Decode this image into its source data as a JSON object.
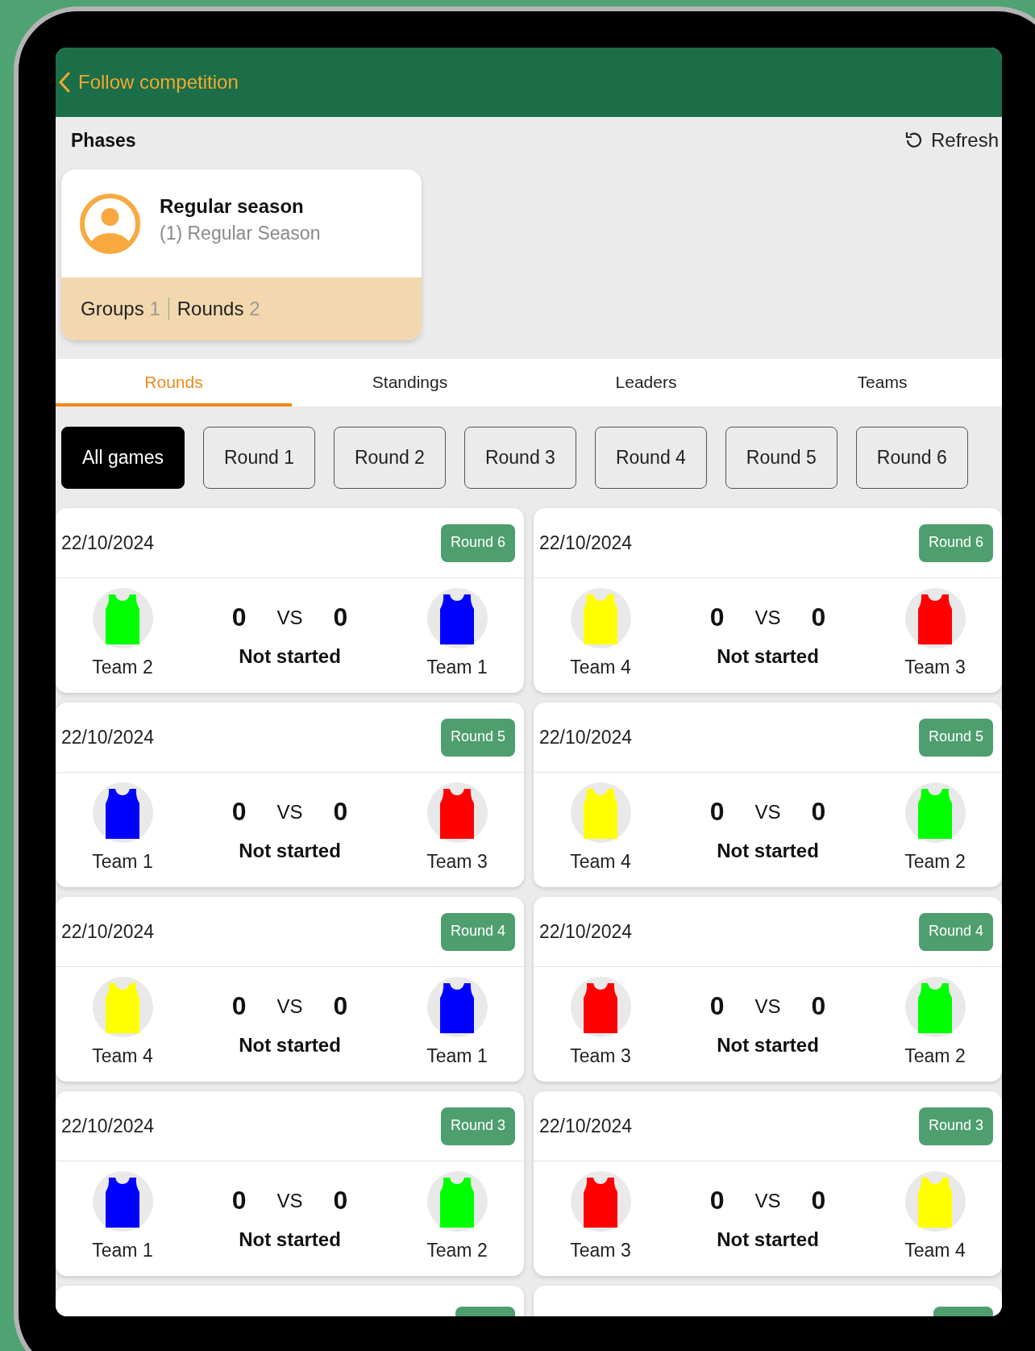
{
  "header": {
    "back_label": "Follow competition"
  },
  "phases_bar": {
    "title": "Phases",
    "refresh_label": "Refresh"
  },
  "phase_card": {
    "title": "Regular season",
    "subtitle": "(1) Regular Season",
    "stats": [
      {
        "label": "Groups",
        "value": "1"
      },
      {
        "label": "Rounds",
        "value": "2"
      }
    ]
  },
  "tabs": [
    {
      "label": "Rounds",
      "selected": true
    },
    {
      "label": "Standings",
      "selected": false
    },
    {
      "label": "Leaders",
      "selected": false
    },
    {
      "label": "Teams",
      "selected": false
    }
  ],
  "round_filters": [
    {
      "label": "All games",
      "selected": true
    },
    {
      "label": "Round 1",
      "selected": false
    },
    {
      "label": "Round 2",
      "selected": false
    },
    {
      "label": "Round 3",
      "selected": false
    },
    {
      "label": "Round 4",
      "selected": false
    },
    {
      "label": "Round 5",
      "selected": false
    },
    {
      "label": "Round 6",
      "selected": false
    }
  ],
  "games": [
    {
      "date": "22/10/2024",
      "round": "Round 6",
      "home": {
        "name": "Team 2",
        "color": "#00ff00"
      },
      "home_score": "0",
      "vs": "VS",
      "away_score": "0",
      "status": "Not started",
      "away": {
        "name": "Team 1",
        "color": "#0000ff"
      }
    },
    {
      "date": "22/10/2024",
      "round": "Round 6",
      "home": {
        "name": "Team 4",
        "color": "#ffff00"
      },
      "home_score": "0",
      "vs": "VS",
      "away_score": "0",
      "status": "Not started",
      "away": {
        "name": "Team 3",
        "color": "#ff0000"
      }
    },
    {
      "date": "22/10/2024",
      "round": "Round 5",
      "home": {
        "name": "Team 1",
        "color": "#0000ff"
      },
      "home_score": "0",
      "vs": "VS",
      "away_score": "0",
      "status": "Not started",
      "away": {
        "name": "Team 3",
        "color": "#ff0000"
      }
    },
    {
      "date": "22/10/2024",
      "round": "Round 5",
      "home": {
        "name": "Team 4",
        "color": "#ffff00"
      },
      "home_score": "0",
      "vs": "VS",
      "away_score": "0",
      "status": "Not started",
      "away": {
        "name": "Team 2",
        "color": "#00ff00"
      }
    },
    {
      "date": "22/10/2024",
      "round": "Round 4",
      "home": {
        "name": "Team 4",
        "color": "#ffff00"
      },
      "home_score": "0",
      "vs": "VS",
      "away_score": "0",
      "status": "Not started",
      "away": {
        "name": "Team 1",
        "color": "#0000ff"
      }
    },
    {
      "date": "22/10/2024",
      "round": "Round 4",
      "home": {
        "name": "Team 3",
        "color": "#ff0000"
      },
      "home_score": "0",
      "vs": "VS",
      "away_score": "0",
      "status": "Not started",
      "away": {
        "name": "Team 2",
        "color": "#00ff00"
      }
    },
    {
      "date": "22/10/2024",
      "round": "Round 3",
      "home": {
        "name": "Team 1",
        "color": "#0000ff"
      },
      "home_score": "0",
      "vs": "VS",
      "away_score": "0",
      "status": "Not started",
      "away": {
        "name": "Team 2",
        "color": "#00ff00"
      }
    },
    {
      "date": "22/10/2024",
      "round": "Round 3",
      "home": {
        "name": "Team 3",
        "color": "#ff0000"
      },
      "home_score": "0",
      "vs": "VS",
      "away_score": "0",
      "status": "Not started",
      "away": {
        "name": "Team 4",
        "color": "#ffff00"
      }
    }
  ]
}
